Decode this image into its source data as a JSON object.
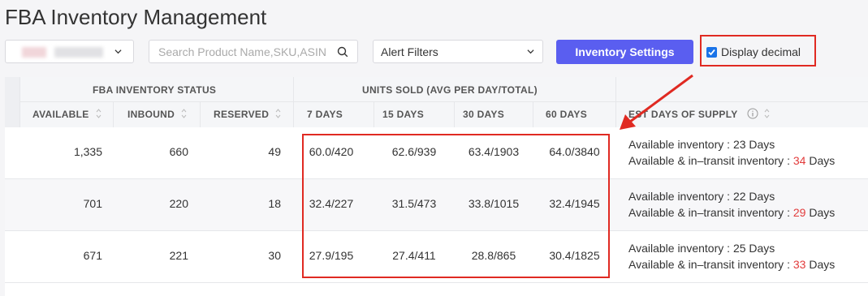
{
  "page_title": "FBA Inventory Management",
  "toolbar": {
    "search_placeholder": "Search Product Name,SKU,ASIN",
    "alert_filter_label": "Alert Filters",
    "settings_button": "Inventory Settings",
    "display_decimal_label": "Display decimal",
    "display_decimal_checked": true
  },
  "table": {
    "groups": {
      "fba_status": "FBA INVENTORY STATUS",
      "units_sold": "UNITS SOLD (AVG PER DAY/TOTAL)"
    },
    "columns": {
      "available": "AVAILABLE",
      "inbound": "INBOUND",
      "reserved": "RESERVED",
      "d7": "7 DAYS",
      "d15": "15 DAYS",
      "d30": "30 DAYS",
      "d60": "60 DAYS",
      "supply": "EST DAYS OF SUPPLY"
    },
    "rows": [
      {
        "available": "1,335",
        "inbound": "660",
        "reserved": "49",
        "d7": "60.0/420",
        "d15": "62.6/939",
        "d30": "63.4/1903",
        "d60": "64.0/3840",
        "supply_available_label": "Available inventory : ",
        "supply_available_days": "23",
        "supply_available_unit": " Days",
        "supply_transit_label": "Available & in–transit inventory : ",
        "supply_transit_days": "34",
        "supply_transit_unit": " Days"
      },
      {
        "available": "701",
        "inbound": "220",
        "reserved": "18",
        "d7": "32.4/227",
        "d15": "31.5/473",
        "d30": "33.8/1015",
        "d60": "32.4/1945",
        "supply_available_label": "Available inventory : ",
        "supply_available_days": "22",
        "supply_available_unit": " Days",
        "supply_transit_label": "Available & in–transit inventory : ",
        "supply_transit_days": "29",
        "supply_transit_unit": " Days"
      },
      {
        "available": "671",
        "inbound": "221",
        "reserved": "30",
        "d7": "27.9/195",
        "d15": "27.4/411",
        "d30": "28.8/865",
        "d60": "30.4/1825",
        "supply_available_label": "Available inventory : ",
        "supply_available_days": "25",
        "supply_available_unit": " Days",
        "supply_transit_label": "Available & in–transit inventory : ",
        "supply_transit_days": "33",
        "supply_transit_unit": " Days"
      }
    ]
  },
  "colors": {
    "accent": "#5a5ef0",
    "highlight_red": "#e02a22",
    "days_red": "#e23b3b"
  }
}
